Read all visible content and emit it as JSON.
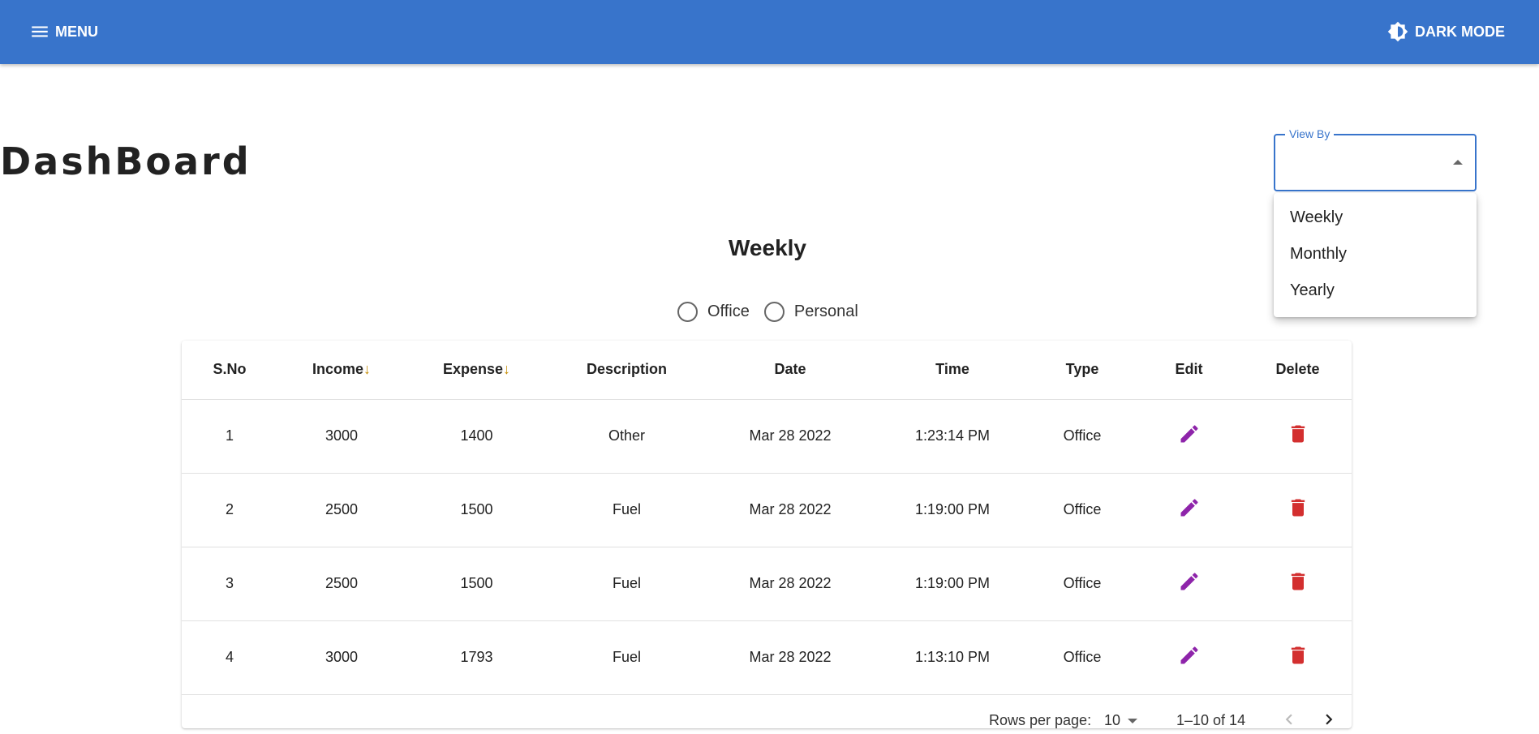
{
  "header": {
    "menu_label": "MENU",
    "dark_mode_label": "DARK MODE"
  },
  "page_title": "DashBoard",
  "view_by": {
    "label": "View By",
    "value": "",
    "options": [
      "Weekly",
      "Monthly",
      "Yearly"
    ]
  },
  "section_title": "Weekly",
  "filters": [
    "Office",
    "Personal"
  ],
  "table": {
    "headers": {
      "sno": "S.No",
      "income": "Income",
      "expense": "Expense",
      "description": "Description",
      "date": "Date",
      "time": "Time",
      "type": "Type",
      "edit": "Edit",
      "delete": "Delete"
    },
    "sort_indicator": "↓",
    "rows": [
      {
        "sno": "1",
        "income": "3000",
        "expense": "1400",
        "description": "Other",
        "date": "Mar 28 2022",
        "time": "1:23:14 PM",
        "type": "Office"
      },
      {
        "sno": "2",
        "income": "2500",
        "expense": "1500",
        "description": "Fuel",
        "date": "Mar 28 2022",
        "time": "1:19:00 PM",
        "type": "Office"
      },
      {
        "sno": "3",
        "income": "2500",
        "expense": "1500",
        "description": "Fuel",
        "date": "Mar 28 2022",
        "time": "1:19:00 PM",
        "type": "Office"
      },
      {
        "sno": "4",
        "income": "3000",
        "expense": "1793",
        "description": "Fuel",
        "date": "Mar 28 2022",
        "time": "1:13:10 PM",
        "type": "Office"
      }
    ]
  },
  "pagination": {
    "rows_per_page_label": "Rows per page:",
    "rows_per_page": "10",
    "range": "1–10 of 14"
  },
  "colors": {
    "appbar": "#3874cb",
    "edit_icon": "#8e24aa",
    "delete_icon": "#d32f2f"
  }
}
